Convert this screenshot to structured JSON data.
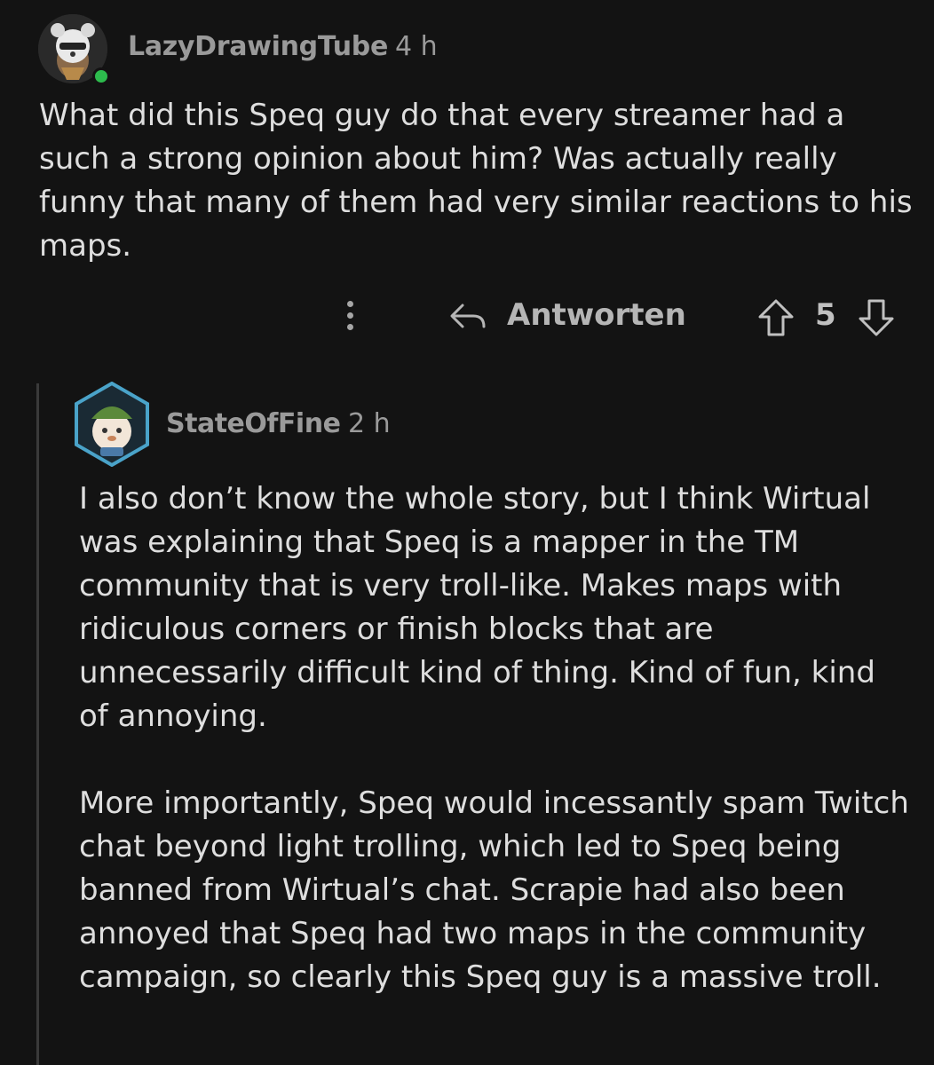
{
  "comment": {
    "author": "LazyDrawingTube",
    "age": "4 h",
    "body": "What did this Speq guy do that every streamer had a such a strong opinion about him? Was actually really funny that many of them had very similar reactions to his maps.",
    "online_color": "#2dbb4d",
    "actions": {
      "more_icon": "more-vertical-icon",
      "reply_icon": "reply-arrow-icon",
      "reply_label": "Antworten",
      "upvote_icon": "arrow-up-icon",
      "score": "5",
      "downvote_icon": "arrow-down-icon"
    }
  },
  "reply": {
    "author": "StateOfFine",
    "age": "2 h",
    "paragraphs": [
      "I also don’t know the whole story, but I think Wirtual was explaining that Speq is a mapper in the TM community that is very troll-like. Makes maps with ridiculous corners or finish blocks that are unnecessarily difficult kind of thing. Kind of fun, kind of annoying.",
      "More importantly, Speq would incessantly spam Twitch chat beyond light trolling, which led to Speq being banned from Wirtual’s chat. Scrapie had also been annoyed that Speq had two maps in the community campaign, so clearly this Speq guy is a massive troll."
    ]
  }
}
